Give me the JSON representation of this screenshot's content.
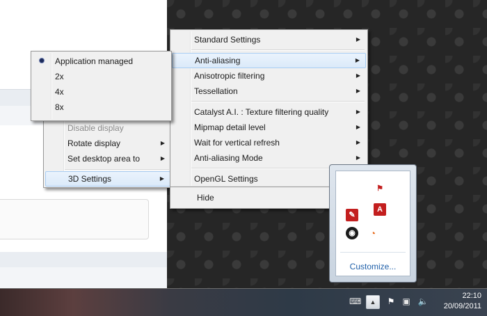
{
  "app_menu": {
    "disable_display": "Disable display",
    "rotate_display": "Rotate display",
    "set_desktop_area": "Set desktop area to",
    "settings_3d": "3D Settings"
  },
  "settings_menu": {
    "standard": "Standard Settings",
    "anti_aliasing": "Anti-aliasing",
    "anisotropic": "Anisotropic filtering",
    "tessellation": "Tessellation",
    "catalyst_ai": "Catalyst A.I. : Texture filtering quality",
    "mipmap": "Mipmap detail level",
    "vsync": "Wait for vertical refresh",
    "aa_mode": "Anti-aliasing Mode",
    "opengl": "OpenGL Settings",
    "hide": "Hide"
  },
  "aa_submenu": {
    "selected": "Application managed",
    "items": [
      "Application managed",
      "2x",
      "4x",
      "8x"
    ]
  },
  "tray": {
    "customize": "Customize..."
  },
  "taskbar": {
    "time": "22:10",
    "date": "20/09/2011"
  },
  "arrow_glyph": "▶",
  "colors": {
    "highlight_border": "#a8cdf3",
    "menu_bg": "#f0f0f0",
    "link_blue": "#1d5ea8"
  }
}
